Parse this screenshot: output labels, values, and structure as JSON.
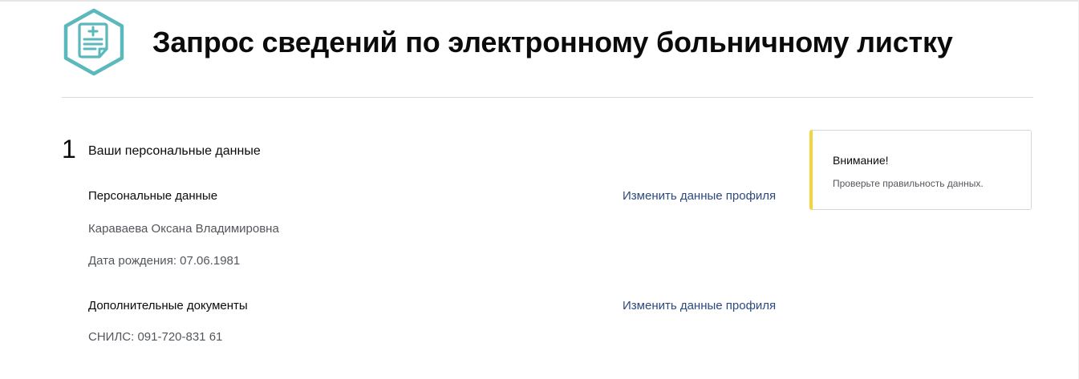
{
  "header": {
    "icon": "medical-document-icon",
    "title": "Запрос сведений по электронному больничному листку"
  },
  "step": {
    "number": "1",
    "title": "Ваши персональные данные"
  },
  "personal": {
    "heading": "Персональные данные",
    "edit_link": "Изменить данные профиля",
    "full_name": "Караваева Оксана Владимировна",
    "birth_date": "Дата рождения: 07.06.1981"
  },
  "documents": {
    "heading": "Дополнительные документы",
    "edit_link": "Изменить данные профиля",
    "snils": "СНИЛС: 091-720-831 61"
  },
  "notice": {
    "title": "Внимание!",
    "text": "Проверьте правильность данных."
  },
  "colors": {
    "accent": "#5bb8bd",
    "link": "#2c4a7c",
    "notice_accent": "#f2d53c"
  }
}
